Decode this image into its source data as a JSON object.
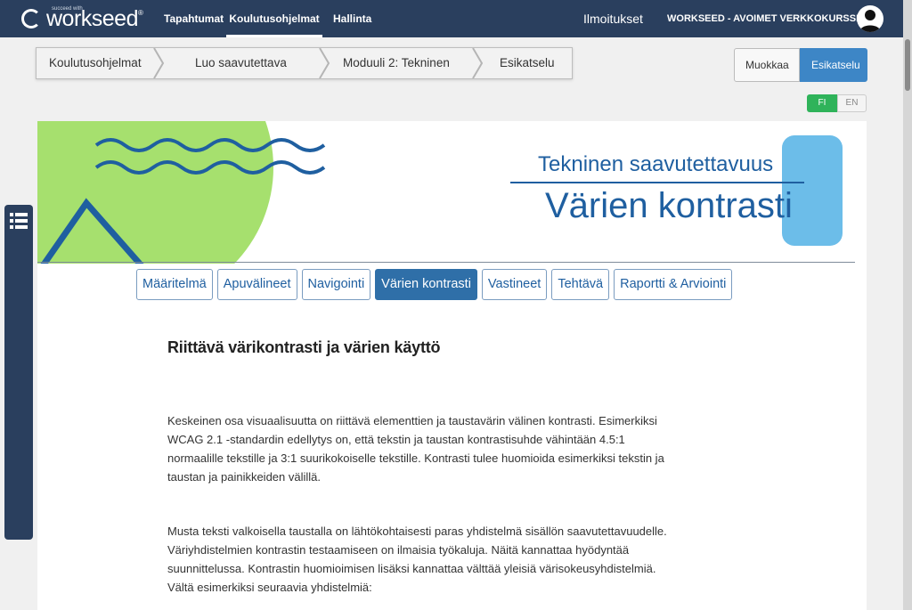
{
  "header": {
    "logo_tagline": "succeed with",
    "logo_text": "workseed",
    "logo_mark": "®",
    "nav": [
      "Tapahtumat",
      "Koulutusohjelmat",
      "Hallinta"
    ],
    "notifications": "Ilmoitukset",
    "org": "WORKSEED - AVOIMET VERKKOKURSSIT",
    "avatar_icon": "user-avatar-icon"
  },
  "breadcrumb": [
    "Koulutusohjelmat",
    "Luo saavutettava",
    "Moduuli 2: Tekninen",
    "Esikatselu"
  ],
  "mode_buttons": {
    "edit": "Muokkaa",
    "preview": "Esikatselu"
  },
  "languages": {
    "fi": "FI",
    "en": "EN",
    "active": "FI"
  },
  "side_panel_icon": "list-icon",
  "banner": {
    "subtitle": "Tekninen saavutettavuus",
    "title": "Värien kontrasti"
  },
  "tabs": [
    {
      "label": "Määritelmä",
      "active": false
    },
    {
      "label": "Apuvälineet",
      "active": false
    },
    {
      "label": "Navigointi",
      "active": false
    },
    {
      "label": "Värien kontrasti",
      "active": true
    },
    {
      "label": "Vastineet",
      "active": false
    },
    {
      "label": "Tehtävä",
      "active": false
    },
    {
      "label": "Raportti & Arviointi",
      "active": false
    }
  ],
  "article": {
    "heading": "Riittävä värikontrasti ja värien käyttö",
    "paragraph1_lines": [
      "Keskeinen osa visuaalisuutta on riittävä elementtien ja taustavärin välinen kontrasti. Esimerkiksi",
      "WCAG 2.1 -standardin edellytys on, että tekstin ja taustan kontrastisuhde vähintään 4.5:1",
      "normaalille tekstille ja 3:1 suurikokoiselle tekstille. Kontrasti tulee huomioida esimerkiksi tekstin ja",
      "taustan ja painikkeiden välillä."
    ],
    "paragraph2_lines": [
      "Musta teksti valkoisella taustalla on lähtökohtaisesti paras yhdistelmä sisällön saavutettavuudelle.",
      "Väriyhdistelmien kontrastin testaamiseen on ilmaisia työkaluja. Näitä kannattaa hyödyntää",
      "suunnittelussa. Kontrastin huomioimisen lisäksi kannattaa välttää yleisiä värisokeusyhdistelmiä.",
      "Vältä esimerkiksi seuraavia yhdistelmiä:"
    ]
  },
  "colors": {
    "nav_bg": "#2a3f5e",
    "accent_blue": "#1f5fa0",
    "active_tab": "#2f6fa8",
    "preview_button": "#3d86c6",
    "lang_active": "#2fb35a",
    "banner_green": "#a6e06e",
    "banner_light_blue": "#6cbde9"
  }
}
